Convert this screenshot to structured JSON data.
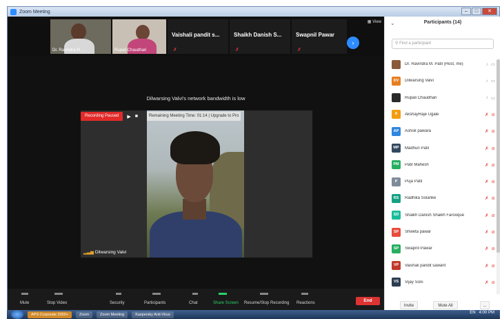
{
  "window": {
    "title": "Zoom Meeting"
  },
  "thumbnails": [
    {
      "name": "Dr. Ravindra M. ..."
    },
    {
      "name": "Rupali Chaudhari"
    },
    {
      "name": "Vaishali pandit s..."
    },
    {
      "name": "Shaikh Danish S..."
    },
    {
      "name": "Swapnil Pawar"
    }
  ],
  "view_label": "View",
  "banner": "Dilwarsing Valvi's network bandwidth is low",
  "video": {
    "recording_status": "Recording Paused",
    "remaining_time": "Remaining Meeting Time: 01:14 | Upgrade to Pro",
    "speaker_name": "Dilwarsing Valvi"
  },
  "toolbar": {
    "mute": "Mute",
    "stop_video": "Stop Video",
    "security": "Security",
    "participants": "Participants",
    "chat": "Chat",
    "share_screen": "Share Screen",
    "record": "Resume/Stop Recording",
    "reactions": "Reactions",
    "end": "End"
  },
  "panel": {
    "title": "Participants (14)",
    "search_placeholder": "Find a participant",
    "invite": "Invite",
    "mute_all": "Mute All",
    "more": "..."
  },
  "participants": [
    {
      "initials": "",
      "name": "Dr. Ravindra M. Patil (Host, me)",
      "color": "#8a5a3a",
      "muted": false
    },
    {
      "initials": "DV",
      "name": "Dilwarsing Valvi",
      "color": "#e67e22",
      "muted": false
    },
    {
      "initials": "",
      "name": "Rupali Chaudhari",
      "color": "#2a2a2a",
      "muted": false
    },
    {
      "initials": "A",
      "name": "AkshayRaje Ugale",
      "color": "#f39c12",
      "muted": true
    },
    {
      "initials": "AP",
      "name": "Ashok pawara",
      "color": "#2e86de",
      "muted": true
    },
    {
      "initials": "MP",
      "name": "Madhuri Patil",
      "color": "#34495e",
      "muted": true
    },
    {
      "initials": "PM",
      "name": "Patil Mahesh",
      "color": "#27ae60",
      "muted": true
    },
    {
      "initials": "P",
      "name": "Puja Patil",
      "color": "#7f8c9a",
      "muted": true
    },
    {
      "initials": "RS",
      "name": "Radhika Solanke",
      "color": "#16a085",
      "muted": true
    },
    {
      "initials": "SD",
      "name": "Shaikh Danish Shaikh Farooque",
      "color": "#1abc9c",
      "muted": true
    },
    {
      "initials": "SP",
      "name": "Shweta pawar",
      "color": "#e74c3c",
      "muted": true
    },
    {
      "initials": "SP",
      "name": "Swapnil Pawar",
      "color": "#27ae60",
      "muted": true
    },
    {
      "initials": "VP",
      "name": "Vaishali pandit sawant",
      "color": "#c0392b",
      "muted": true
    },
    {
      "initials": "VS",
      "name": "Vijay Soni",
      "color": "#2c3e50",
      "muted": true
    }
  ],
  "taskbar": {
    "items": [
      "APS Corporate 2000+",
      "Zoom",
      "Zoom Meeting",
      "Kaspersky Anti-Virus"
    ],
    "lang": "EN",
    "time": "4:00 PM"
  }
}
